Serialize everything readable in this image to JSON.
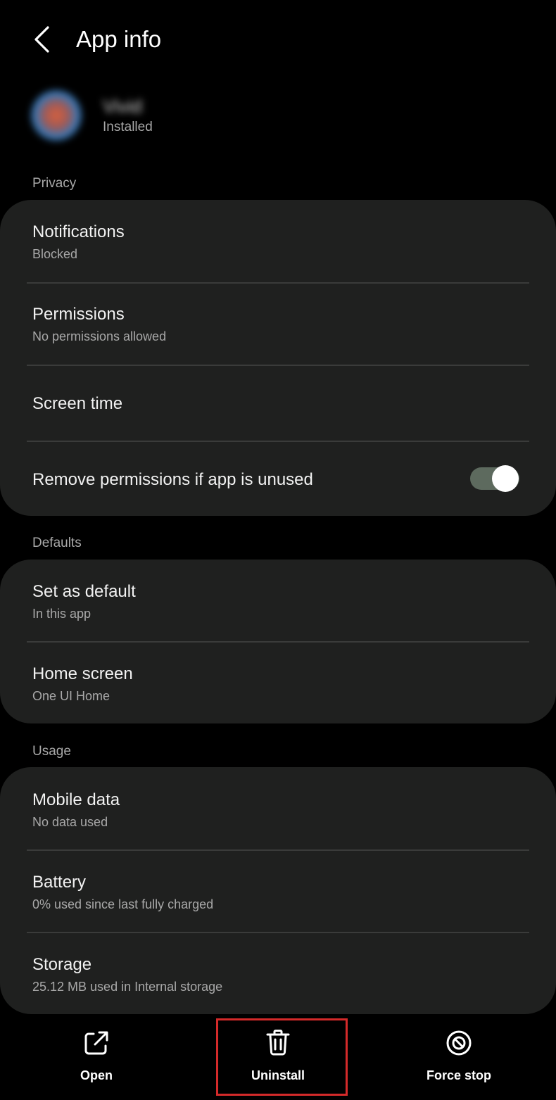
{
  "header": {
    "title": "App info"
  },
  "app": {
    "name": "Vivid",
    "status": "Installed"
  },
  "sections": [
    {
      "label": "Privacy",
      "items": [
        {
          "title": "Notifications",
          "subtitle": "Blocked"
        },
        {
          "title": "Permissions",
          "subtitle": "No permissions allowed"
        },
        {
          "title": "Screen time"
        },
        {
          "title": "Remove permissions if app is unused",
          "toggle_on": true
        }
      ]
    },
    {
      "label": "Defaults",
      "items": [
        {
          "title": "Set as default",
          "subtitle": "In this app"
        },
        {
          "title": "Home screen",
          "subtitle": "One UI Home"
        }
      ]
    },
    {
      "label": "Usage",
      "items": [
        {
          "title": "Mobile data",
          "subtitle": "No data used"
        },
        {
          "title": "Battery",
          "subtitle": "0% used since last fully charged"
        },
        {
          "title": "Storage",
          "subtitle": "25.12 MB used in Internal storage"
        }
      ]
    }
  ],
  "actions": [
    {
      "label": "Open",
      "icon": "open-external-icon"
    },
    {
      "label": "Uninstall",
      "icon": "trash-icon"
    },
    {
      "label": "Force stop",
      "icon": "force-stop-icon"
    }
  ],
  "colors": {
    "background": "#000000",
    "card": "#1f201f",
    "text_primary": "#f2f2f2",
    "text_secondary": "#a8a8a8",
    "toggle_track": "#5d6a5e",
    "highlight_border": "#d42a2a"
  }
}
